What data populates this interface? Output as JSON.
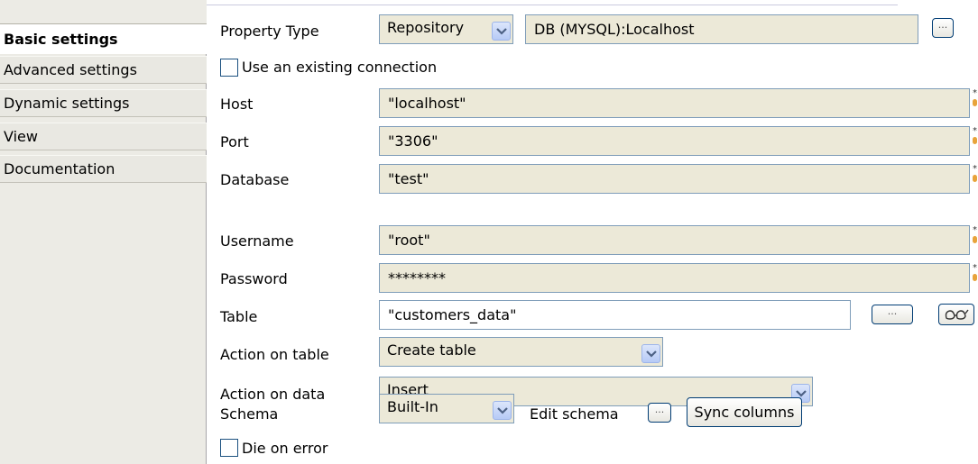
{
  "sidebar": {
    "items": [
      {
        "label": "Basic settings"
      },
      {
        "label": "Advanced settings"
      },
      {
        "label": "Dynamic settings"
      },
      {
        "label": "View"
      },
      {
        "label": "Documentation"
      }
    ]
  },
  "form": {
    "property_type": {
      "label": "Property Type",
      "value": "Repository",
      "repository": "DB (MYSQL):Localhost"
    },
    "use_existing_connection": {
      "label": "Use an existing connection",
      "checked": false
    },
    "host": {
      "label": "Host",
      "value": "\"localhost\""
    },
    "port": {
      "label": "Port",
      "value": "\"3306\""
    },
    "database": {
      "label": "Database",
      "value": "\"test\""
    },
    "username": {
      "label": "Username",
      "value": "\"root\""
    },
    "password": {
      "label": "Password",
      "value": "********"
    },
    "table": {
      "label": "Table",
      "value": "\"customers_data\""
    },
    "action_on_table": {
      "label": "Action on table",
      "value": "Create table"
    },
    "action_on_data": {
      "label": "Action on data",
      "value": "Insert"
    },
    "schema": {
      "label": "Schema",
      "value": "Built-In",
      "edit_label": "Edit schema",
      "sync_label": "Sync columns"
    },
    "die_on_error": {
      "label": "Die on error",
      "checked": false
    },
    "dots_label": "..."
  },
  "icons": {
    "combo_arrow": "chevron-down-icon",
    "guess_table": "glasses-icon",
    "required_marker": "context-icon"
  },
  "colors": {
    "field_bg": "#ece9d8",
    "field_border": "#7f9db9",
    "arrow_color": "#4d6185"
  }
}
